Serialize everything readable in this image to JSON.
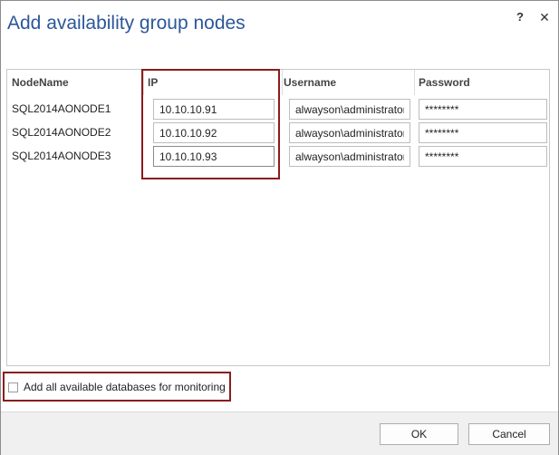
{
  "dialog": {
    "title": "Add availability group nodes",
    "help_label": "?",
    "close_label": "✕"
  },
  "grid": {
    "columns": [
      "NodeName",
      "IP",
      "Username",
      "Password"
    ],
    "rows": [
      {
        "node_name": "SQL2014AONODE1",
        "ip": "10.10.10.91",
        "username": "alwayson\\administrator",
        "password": "********"
      },
      {
        "node_name": "SQL2014AONODE2",
        "ip": "10.10.10.92",
        "username": "alwayson\\administrator",
        "password": "********"
      },
      {
        "node_name": "SQL2014AONODE3",
        "ip": "10.10.10.93",
        "username": "alwayson\\administrator",
        "password": "********"
      }
    ]
  },
  "options": {
    "add_all_databases_label": "Add all available databases for monitoring",
    "add_all_databases_checked": false
  },
  "footer": {
    "ok_label": "OK",
    "cancel_label": "Cancel"
  },
  "colors": {
    "title": "#2b579a",
    "highlight": "#8b1c1c"
  }
}
